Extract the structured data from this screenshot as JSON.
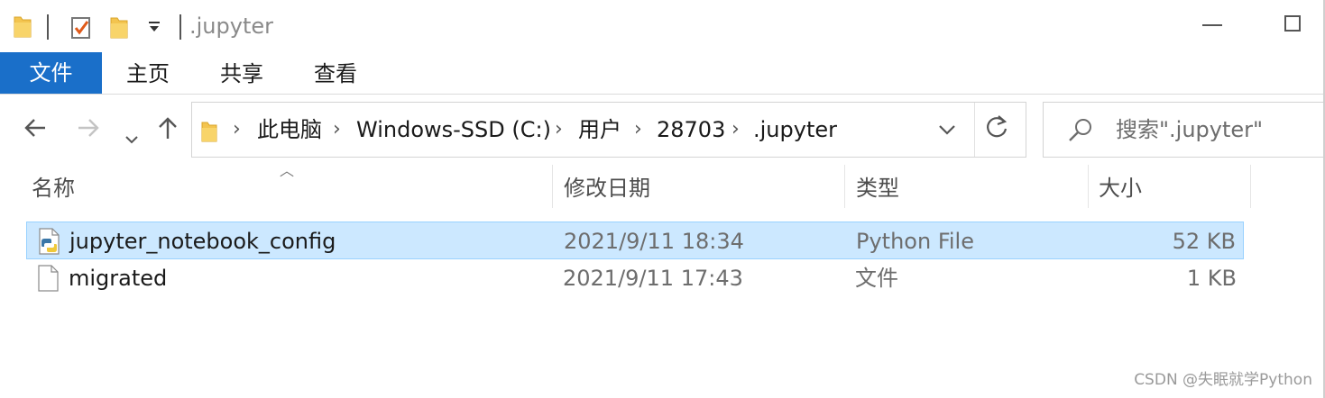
{
  "window": {
    "title": ".jupyter"
  },
  "ribbon": {
    "tabs": [
      "文件",
      "主页",
      "共享",
      "查看"
    ]
  },
  "address_bar": {
    "crumbs": [
      "此电脑",
      "Windows-SSD (C:)",
      "用户",
      "28703",
      ".jupyter"
    ]
  },
  "search": {
    "placeholder": "搜索\".jupyter\""
  },
  "columns": {
    "name": "名称",
    "date": "修改日期",
    "type": "类型",
    "size": "大小"
  },
  "files": [
    {
      "name": "jupyter_notebook_config",
      "date": "2021/9/11 18:34",
      "type": "Python File",
      "size": "52 KB",
      "icon": "python-file-icon",
      "selected": true
    },
    {
      "name": "migrated",
      "date": "2021/9/11 17:43",
      "type": "文件",
      "size": "1 KB",
      "icon": "blank-file-icon",
      "selected": false
    }
  ],
  "watermark": "CSDN @失眠就学Python",
  "colors": {
    "accent": "#1a6fc9",
    "selection": "#cce8ff",
    "folder": "#f3c44f"
  }
}
